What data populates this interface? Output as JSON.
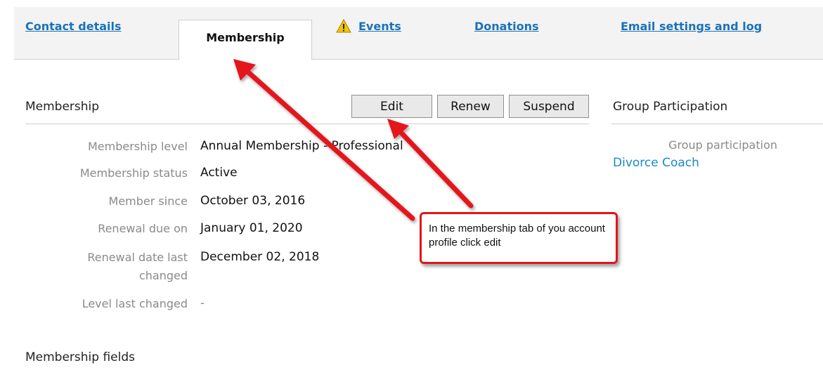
{
  "tabs": {
    "contact_details": "Contact details",
    "membership": "Membership",
    "events": "Events",
    "donations": "Donations",
    "email_settings": "Email settings and log"
  },
  "membership_section": {
    "title": "Membership",
    "buttons": {
      "edit": "Edit",
      "renew": "Renew",
      "suspend": "Suspend"
    },
    "fields": [
      {
        "label": "Membership level",
        "value": "Annual Membership - Professional"
      },
      {
        "label": "Membership status",
        "value": "Active"
      },
      {
        "label": "Member since",
        "value": "October 03, 2016"
      },
      {
        "label": "Renewal due on",
        "value": "January 01, 2020"
      },
      {
        "label_line1": "Renewal date last",
        "label_line2": "changed",
        "value": "December 02, 2018"
      },
      {
        "label": "Level last changed",
        "value": "-"
      }
    ]
  },
  "group_participation": {
    "title": "Group Participation",
    "label": "Group participation",
    "link": "Divorce Coach"
  },
  "membership_fields_title": "Membership fields",
  "callout": {
    "text": "In the membership tab of you account profile click edit"
  },
  "colors": {
    "link": "#1a73b8",
    "annotation": "#e4141b",
    "warning": "#f5c400"
  },
  "icons": {
    "events_tab": "warning-icon"
  }
}
